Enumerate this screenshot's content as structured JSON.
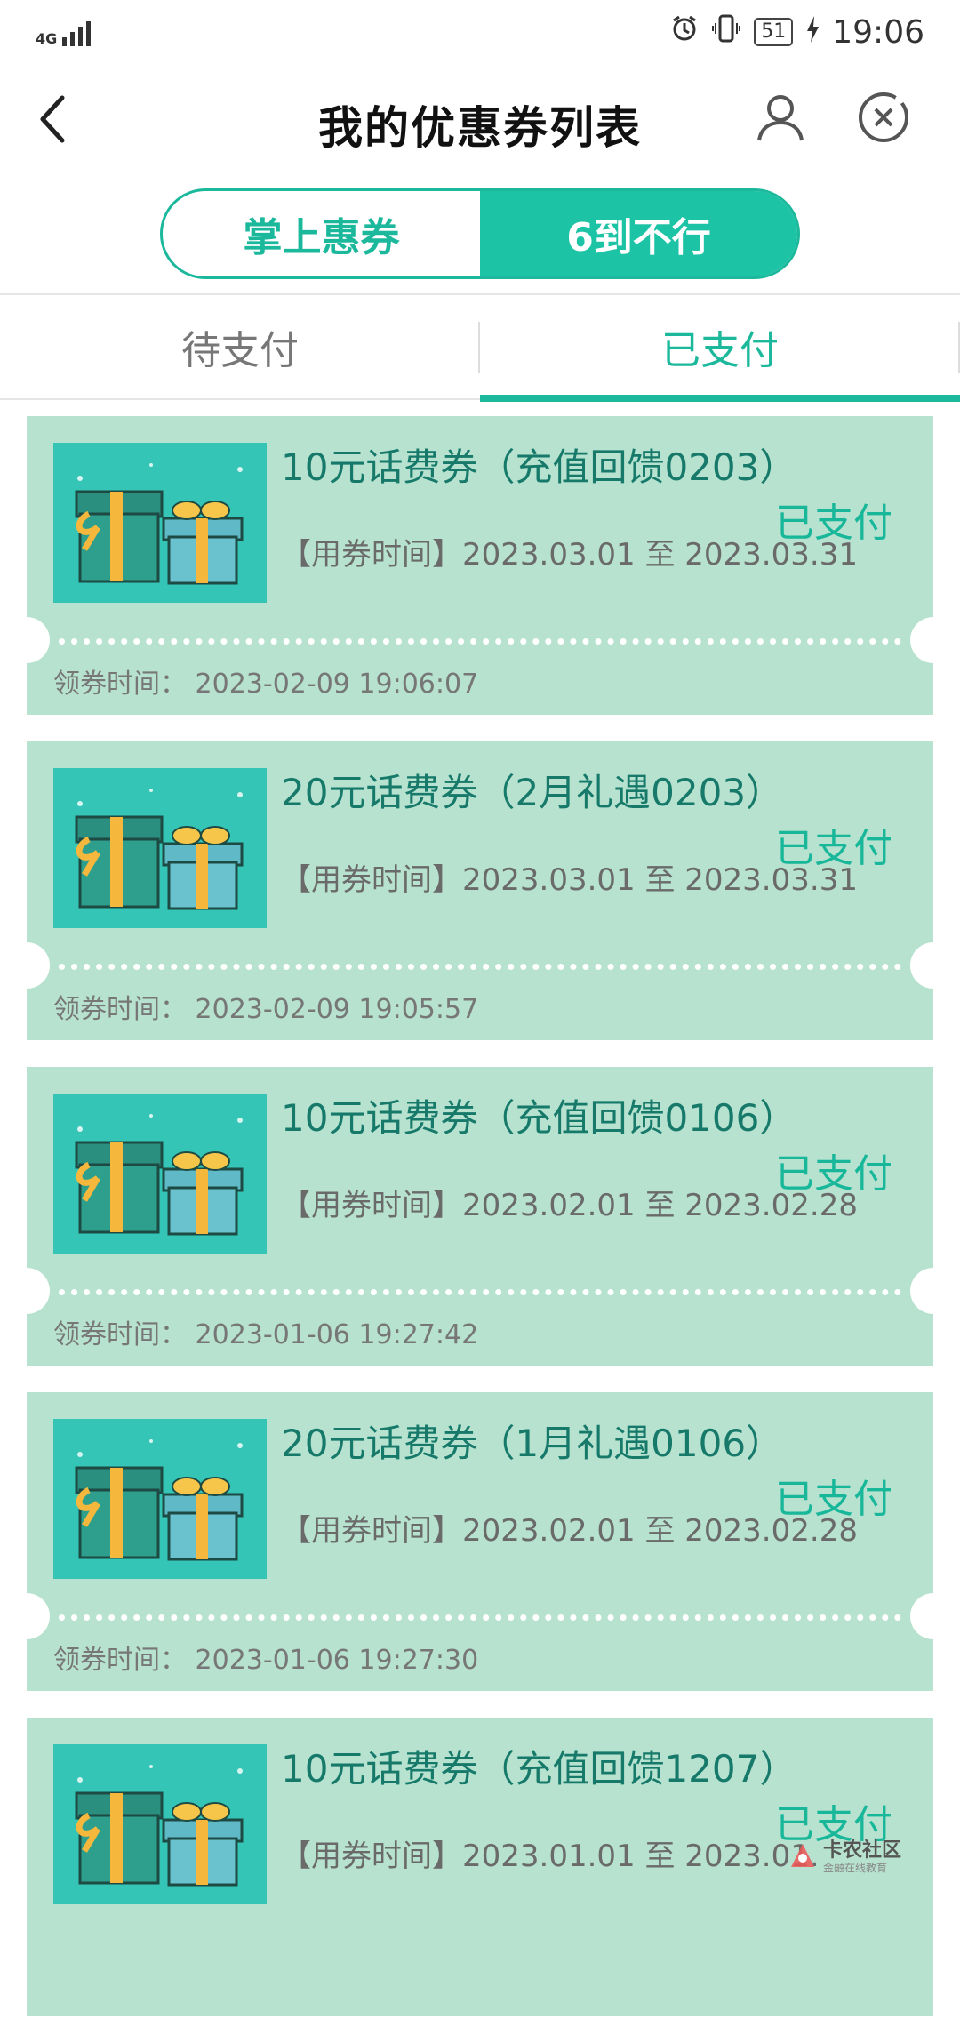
{
  "status_bar": {
    "network": "4G",
    "time": "19:06",
    "battery": "51"
  },
  "header": {
    "title": "我的优惠券列表"
  },
  "segment": {
    "left": "掌上惠券",
    "right": "6到不行"
  },
  "subtabs": {
    "pending": "待支付",
    "paid": "已支付"
  },
  "colors": {
    "accent": "#1bb89c",
    "card": "#b6e2cf",
    "thumb": "#34c5b6"
  },
  "coupons": [
    {
      "title": "10元话费券（充值回馈0203）",
      "status": "已支付",
      "date_label": "【用券时间】2023.03.01 至 2023.03.31",
      "claim": "领券时间：  2023-02-09 19:06:07"
    },
    {
      "title": "20元话费券（2月礼遇0203）",
      "status": "已支付",
      "date_label": "【用券时间】2023.03.01 至 2023.03.31",
      "claim": "领券时间：  2023-02-09 19:05:57"
    },
    {
      "title": "10元话费券（充值回馈0106）",
      "status": "已支付",
      "date_label": "【用券时间】2023.02.01 至 2023.02.28",
      "claim": "领券时间：  2023-01-06 19:27:42"
    },
    {
      "title": "20元话费券（1月礼遇0106）",
      "status": "已支付",
      "date_label": "【用券时间】2023.02.01 至 2023.02.28",
      "claim": "领券时间：  2023-01-06 19:27:30"
    },
    {
      "title": "10元话费券（充值回馈1207）",
      "status": "已支付",
      "date_label": "【用券时间】2023.01.01 至 2023.01.",
      "claim": ""
    }
  ],
  "watermark": {
    "name": "卡农社区",
    "sub": "金融在线教育"
  }
}
